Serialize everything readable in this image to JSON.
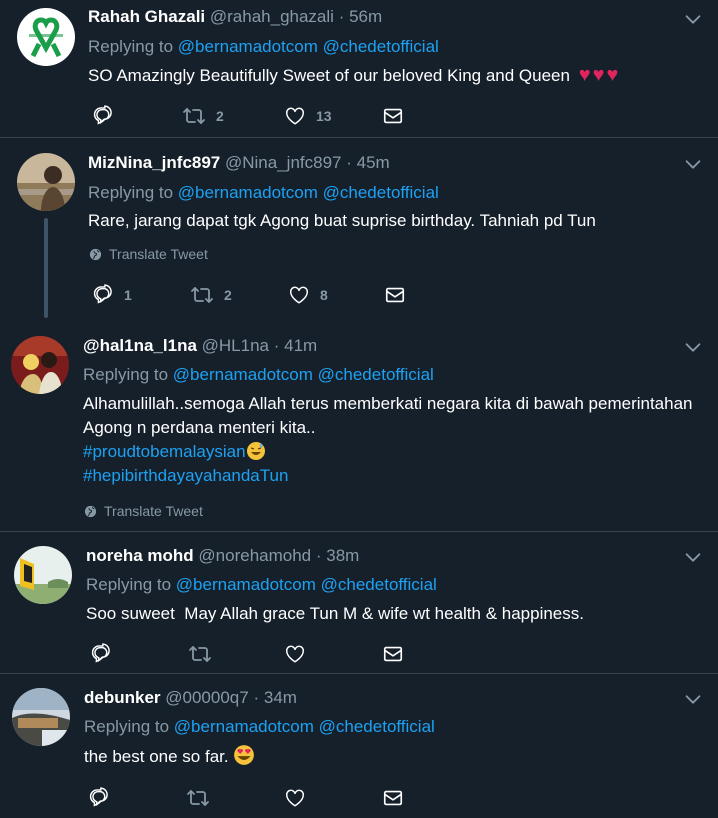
{
  "tweets": [
    {
      "name": "Rahah Ghazali",
      "handle": "@rahah_ghazali",
      "time": "56m",
      "replying_prefix": "Replying to",
      "mention1": "@bernamadotcom",
      "mention2": "@chedetofficial",
      "text": "SO Amazingly Beautifully Sweet of our beloved King and Queen",
      "emoji": "♥♥♥",
      "replies": "",
      "retweets": "2",
      "likes": "13"
    },
    {
      "name": "MizNina_jnfc897",
      "handle": "@Nina_jnfc897",
      "time": "45m",
      "replying_prefix": "Replying to",
      "mention1": "@bernamadotcom",
      "mention2": "@chedetofficial",
      "text": "Rare, jarang dapat tgk Agong buat suprise birthday. Tahniah pd Tun",
      "translate": "Translate Tweet",
      "replies": "1",
      "retweets": "2",
      "likes": "8"
    },
    {
      "name": "@hal1na_l1na",
      "handle": "@HL1na",
      "time": "41m",
      "replying_prefix": "Replying to",
      "mention1": "@bernamadotcom",
      "mention2": "@chedetofficial",
      "text": "Alhamulillah..semoga Allah terus memberkati negara kita di bawah pemerintahan Agong n perdana menteri kita..",
      "hashtag1": "#proudtobemalaysian",
      "hashtag2": "#hepibirthdayayahandaTun",
      "translate": "Translate Tweet"
    },
    {
      "name": "noreha mohd",
      "handle": "@norehamohd",
      "time": "38m",
      "replying_prefix": "Replying to",
      "mention1": "@bernamadotcom",
      "mention2": "@chedetofficial",
      "text": "Soo suweet  May Allah grace Tun M & wife wt health & happiness."
    },
    {
      "name": "debunker",
      "handle": "@00000q7",
      "time": "34m",
      "replying_prefix": "Replying to",
      "mention1": "@bernamadotcom",
      "mention2": "@chedetofficial",
      "text": "the best one so far."
    }
  ],
  "ui": {
    "dot": "·"
  },
  "colors": {
    "background": "#15202b",
    "accent": "#1da1f2",
    "muted": "#8899a6",
    "heart": "#e0245e"
  }
}
